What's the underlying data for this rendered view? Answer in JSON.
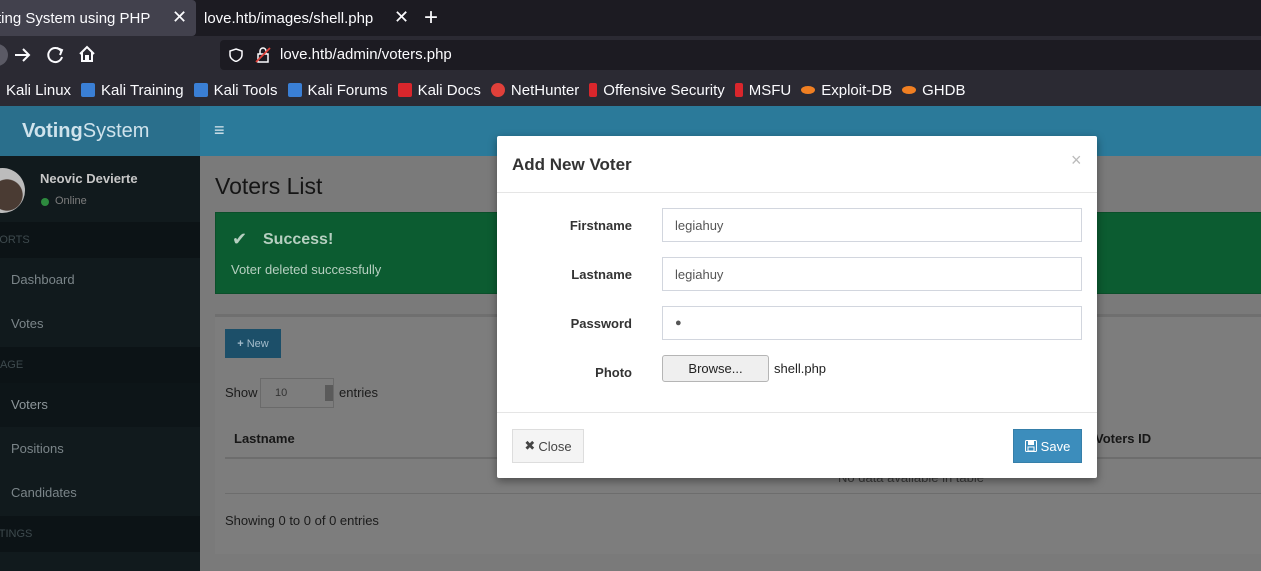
{
  "browser": {
    "tabs": [
      {
        "label": "ting System using PHP",
        "active": true
      },
      {
        "label": "love.htb/images/shell.php",
        "active": false
      }
    ],
    "close_glyph": "✕",
    "new_tab_glyph": "+",
    "url": "love.htb/admin/voters.php",
    "bookmarks": [
      {
        "label": "Kali Linux",
        "icon": "kali-icon",
        "color": "#3a7fd5"
      },
      {
        "label": "Kali Training",
        "icon": "kali-icon",
        "color": "#3a7fd5"
      },
      {
        "label": "Kali Tools",
        "icon": "kali-icon",
        "color": "#3a7fd5"
      },
      {
        "label": "Kali Forums",
        "icon": "kali-icon",
        "color": "#3a7fd5"
      },
      {
        "label": "Kali Docs",
        "icon": "kali-docs-icon",
        "color": "#d9262c"
      },
      {
        "label": "NetHunter",
        "icon": "nethunter-icon",
        "color": "#e0403a"
      },
      {
        "label": "Offensive Security",
        "icon": "offsec-icon",
        "color": "#d9262c"
      },
      {
        "label": "MSFU",
        "icon": "offsec-icon",
        "color": "#d9262c"
      },
      {
        "label": "Exploit-DB",
        "icon": "exploitdb-icon",
        "color": "#f07f22"
      },
      {
        "label": "GHDB",
        "icon": "exploitdb-icon",
        "color": "#f07f22"
      }
    ]
  },
  "app": {
    "logo_bold": "Voting",
    "logo_rest": "System",
    "hamburger": "≡",
    "user": {
      "name": "Neovic Devierte",
      "status": "Online"
    },
    "sidebar": {
      "sections": [
        {
          "label": "PORTS",
          "items": [
            "Dashboard",
            "Votes"
          ]
        },
        {
          "label": "NAGE",
          "items": [
            "Voters",
            "Positions",
            "Candidates"
          ]
        },
        {
          "label": "TTINGS",
          "items": []
        }
      ],
      "active": "Voters"
    },
    "page_title": "Voters List",
    "alert": {
      "title": "Success!",
      "message": "Voter deleted successfully",
      "check": "✔"
    },
    "new_button": "New",
    "show_label": "Show",
    "page_size": "10",
    "entries_label": "entries",
    "table": {
      "columns": [
        "Lastname",
        "Voters ID"
      ],
      "empty_message": "No data available in table"
    },
    "showing": "Showing 0 to 0 of 0 entries"
  },
  "modal": {
    "title": "Add New Voter",
    "close_glyph": "×",
    "fields": {
      "firstname": {
        "label": "Firstname",
        "value": "legiahuy"
      },
      "lastname": {
        "label": "Lastname",
        "value": "legiahuy"
      },
      "password": {
        "label": "Password",
        "value": "●"
      },
      "photo": {
        "label": "Photo",
        "browse": "Browse...",
        "file": "shell.php"
      }
    },
    "close_button": "Close",
    "save_button": "Save"
  }
}
